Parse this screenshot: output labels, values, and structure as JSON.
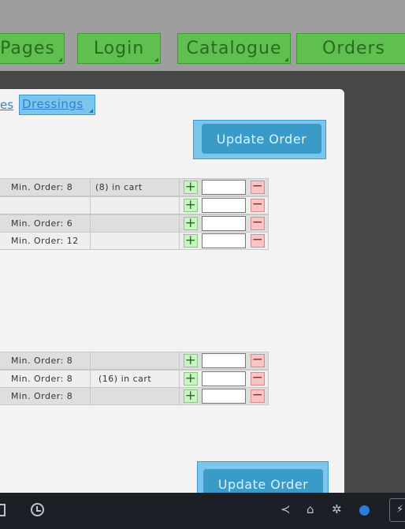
{
  "nav": {
    "tabs": [
      {
        "label": "Pages"
      },
      {
        "label": "Login"
      },
      {
        "label": "Catalogue"
      },
      {
        "label": "Orders"
      }
    ]
  },
  "breadcrumb": {
    "previous": "es",
    "current": "Dressings"
  },
  "buttons": {
    "update_top": "Update Order",
    "update_bottom": "Update Order"
  },
  "group1": {
    "rows": [
      {
        "min_order": "Min. Order: 8",
        "cart": "(8) in cart"
      },
      {
        "min_order": "",
        "cart": ""
      },
      {
        "min_order": "Min. Order: 6",
        "cart": ""
      },
      {
        "min_order": "Min. Order: 12",
        "cart": ""
      }
    ]
  },
  "group2": {
    "rows": [
      {
        "min_order": "Min. Order: 8",
        "cart": ""
      },
      {
        "min_order": "Min. Order: 8",
        "cart": "(16) in cart"
      },
      {
        "min_order": "Min. Order: 8",
        "cart": ""
      }
    ]
  },
  "controls": {
    "plus": "+",
    "minus": "−"
  },
  "taskbar": {
    "icons": [
      "document-icon",
      "clock-icon",
      "share-icon",
      "home-icon",
      "gear-icon",
      "status-dot-icon",
      "bolt-icon"
    ],
    "glyphs": {
      "share": "≺",
      "home": "⌂",
      "gear": "✲",
      "bolt": "⚡"
    }
  },
  "colors": {
    "nav_tab": "#5fbf4f",
    "highlight": "#7cc6ee",
    "update_button": "#3a9bc9",
    "plus_bg": "#c9f5c4",
    "minus_bg": "#f8c4c4",
    "taskbar": "#1c1f25"
  }
}
